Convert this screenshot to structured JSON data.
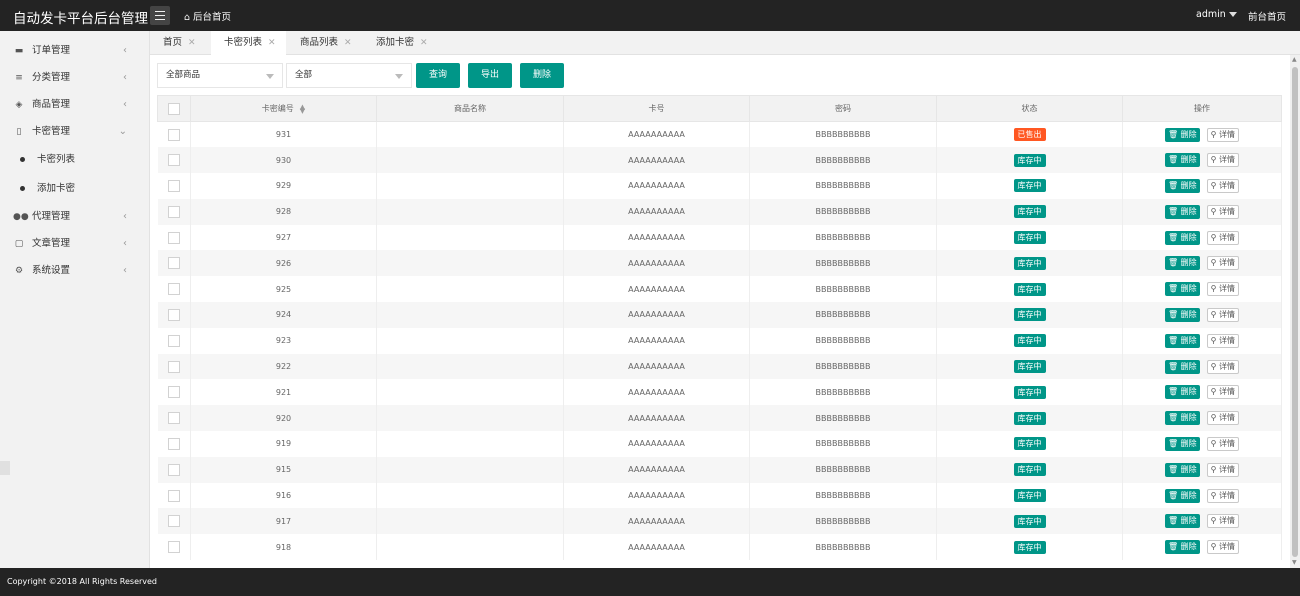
{
  "header": {
    "title": "自动发卡平台后台管理",
    "home_link": "后台首页",
    "user": "admin",
    "frontend_link": "前台首页"
  },
  "sidebar": {
    "items": [
      {
        "label": "订单管理",
        "icon": "wallet-icon"
      },
      {
        "label": "分类管理",
        "icon": "list-icon"
      },
      {
        "label": "商品管理",
        "icon": "cube-icon"
      },
      {
        "label": "卡密管理",
        "icon": "clipboard-icon"
      },
      {
        "label": "代理管理",
        "icon": "users-icon"
      },
      {
        "label": "文章管理",
        "icon": "document-icon"
      },
      {
        "label": "系统设置",
        "icon": "settings-icon"
      }
    ],
    "sub_items": [
      "卡密列表",
      "添加卡密"
    ]
  },
  "tabs": [
    {
      "label": "首页"
    },
    {
      "label": "卡密列表"
    },
    {
      "label": "商品列表"
    },
    {
      "label": "添加卡密"
    }
  ],
  "filters": {
    "product_select": "全部商品",
    "status_select": "全部",
    "query_button": "查询",
    "export_button": "导出",
    "delete_button": "删除"
  },
  "table": {
    "columns": [
      "卡密编号",
      "商品名称",
      "卡号",
      "密码",
      "状态",
      "操作"
    ],
    "delete_label": "删除",
    "detail_label": "详情",
    "rows": [
      {
        "id": "931",
        "product": "",
        "card": "AAAAAAAAAA",
        "password": "BBBBBBBBBB",
        "status": "已售出"
      },
      {
        "id": "930",
        "product": "",
        "card": "AAAAAAAAAA",
        "password": "BBBBBBBBBB",
        "status": "库存中"
      },
      {
        "id": "929",
        "product": "",
        "card": "AAAAAAAAAA",
        "password": "BBBBBBBBBB",
        "status": "库存中"
      },
      {
        "id": "928",
        "product": "",
        "card": "AAAAAAAAAA",
        "password": "BBBBBBBBBB",
        "status": "库存中"
      },
      {
        "id": "927",
        "product": "",
        "card": "AAAAAAAAAA",
        "password": "BBBBBBBBBB",
        "status": "库存中"
      },
      {
        "id": "926",
        "product": "",
        "card": "AAAAAAAAAA",
        "password": "BBBBBBBBBB",
        "status": "库存中"
      },
      {
        "id": "925",
        "product": "",
        "card": "AAAAAAAAAA",
        "password": "BBBBBBBBBB",
        "status": "库存中"
      },
      {
        "id": "924",
        "product": "",
        "card": "AAAAAAAAAA",
        "password": "BBBBBBBBBB",
        "status": "库存中"
      },
      {
        "id": "923",
        "product": "",
        "card": "AAAAAAAAAA",
        "password": "BBBBBBBBBB",
        "status": "库存中"
      },
      {
        "id": "922",
        "product": "",
        "card": "AAAAAAAAAA",
        "password": "BBBBBBBBBB",
        "status": "库存中"
      },
      {
        "id": "921",
        "product": "",
        "card": "AAAAAAAAAA",
        "password": "BBBBBBBBBB",
        "status": "库存中"
      },
      {
        "id": "920",
        "product": "",
        "card": "AAAAAAAAAA",
        "password": "BBBBBBBBBB",
        "status": "库存中"
      },
      {
        "id": "919",
        "product": "",
        "card": "AAAAAAAAAA",
        "password": "BBBBBBBBBB",
        "status": "库存中"
      },
      {
        "id": "915",
        "product": "",
        "card": "AAAAAAAAAA",
        "password": "BBBBBBBBBB",
        "status": "库存中"
      },
      {
        "id": "916",
        "product": "",
        "card": "AAAAAAAAAA",
        "password": "BBBBBBBBBB",
        "status": "库存中"
      },
      {
        "id": "917",
        "product": "",
        "card": "AAAAAAAAAA",
        "password": "BBBBBBBBBB",
        "status": "库存中"
      },
      {
        "id": "918",
        "product": "",
        "card": "AAAAAAAAAA",
        "password": "BBBBBBBBBB",
        "status": "库存中"
      }
    ]
  },
  "footer": {
    "copyright": "Copyright ©2018 All Rights Reserved"
  },
  "colors": {
    "header_bg": "#232323",
    "accent": "#009688",
    "sold": "#ff5722"
  }
}
